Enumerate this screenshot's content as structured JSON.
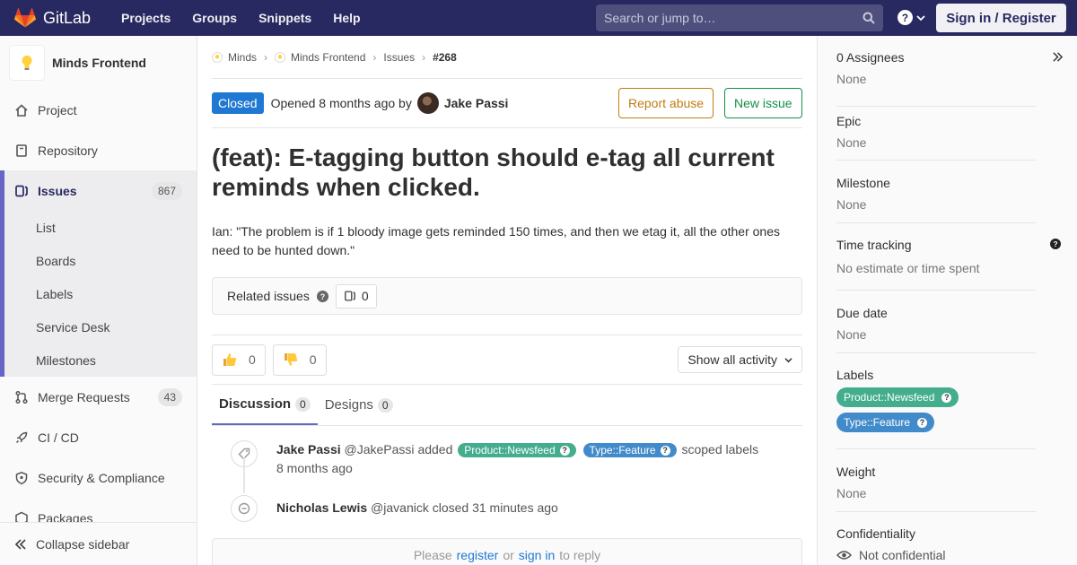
{
  "navbar": {
    "brand": "GitLab",
    "links": [
      "Projects",
      "Groups",
      "Snippets",
      "Help"
    ],
    "search_placeholder": "Search or jump to…",
    "signin_label": "Sign in / Register"
  },
  "sidebar": {
    "project_name": "Minds Frontend",
    "items": [
      {
        "label": "Project",
        "icon": "home-icon"
      },
      {
        "label": "Repository",
        "icon": "book-icon"
      },
      {
        "label": "Issues",
        "icon": "issues-icon",
        "count": "867"
      },
      {
        "label": "Merge Requests",
        "icon": "merge-request-icon",
        "count": "43"
      },
      {
        "label": "CI / CD",
        "icon": "rocket-icon"
      },
      {
        "label": "Security & Compliance",
        "icon": "shield-icon"
      },
      {
        "label": "Packages",
        "icon": "package-icon"
      }
    ],
    "issue_subitems": [
      "List",
      "Boards",
      "Labels",
      "Service Desk",
      "Milestones"
    ],
    "collapse_label": "Collapse sidebar"
  },
  "breadcrumb": {
    "items": [
      "Minds",
      "Minds Frontend",
      "Issues"
    ],
    "current": "#268"
  },
  "issue": {
    "status": "Closed",
    "opened_text": "Opened 8 months ago by",
    "author": "Jake Passi",
    "report_label": "Report abuse",
    "new_label": "New issue",
    "title": "(feat): E-tagging button should e-tag all current reminds when clicked.",
    "description": "Ian: \"The problem is if 1 bloody image gets reminded 150 times, and then we etag it, all the other ones need to be hunted down.\"",
    "related_label": "Related issues",
    "related_count": "0",
    "thumbs_up": "0",
    "thumbs_down": "0",
    "activity_label": "Show all activity"
  },
  "tabs": [
    {
      "label": "Discussion",
      "count": "0"
    },
    {
      "label": "Designs",
      "count": "0"
    }
  ],
  "notes": [
    {
      "author": "Jake Passi",
      "handle": "@JakePassi",
      "action": "added",
      "labels": [
        "Product::Newsfeed",
        "Type::Feature"
      ],
      "suffix": "scoped labels",
      "time": "8 months ago"
    },
    {
      "author": "Nicholas Lewis",
      "handle": "@javanick",
      "action": "closed 31 minutes ago"
    }
  ],
  "reply": {
    "prefix": "Please",
    "register": "register",
    "or": "or",
    "signin": "sign in",
    "suffix": "to reply"
  },
  "rsidebar": {
    "assignees_title": "0 Assignees",
    "assignees_value": "None",
    "epic_title": "Epic",
    "epic_value": "None",
    "milestone_title": "Milestone",
    "milestone_value": "None",
    "time_title": "Time tracking",
    "time_value": "No estimate or time spent",
    "due_title": "Due date",
    "due_value": "None",
    "labels_title": "Labels",
    "labels": [
      "Product::Newsfeed",
      "Type::Feature"
    ],
    "weight_title": "Weight",
    "weight_value": "None",
    "conf_title": "Confidentiality",
    "conf_value": "Not confidential"
  },
  "colors": {
    "navbar": "#292961",
    "label_newsfeed": "#44ad8e",
    "label_feature": "#428bca",
    "closed": "#1f78d1"
  }
}
